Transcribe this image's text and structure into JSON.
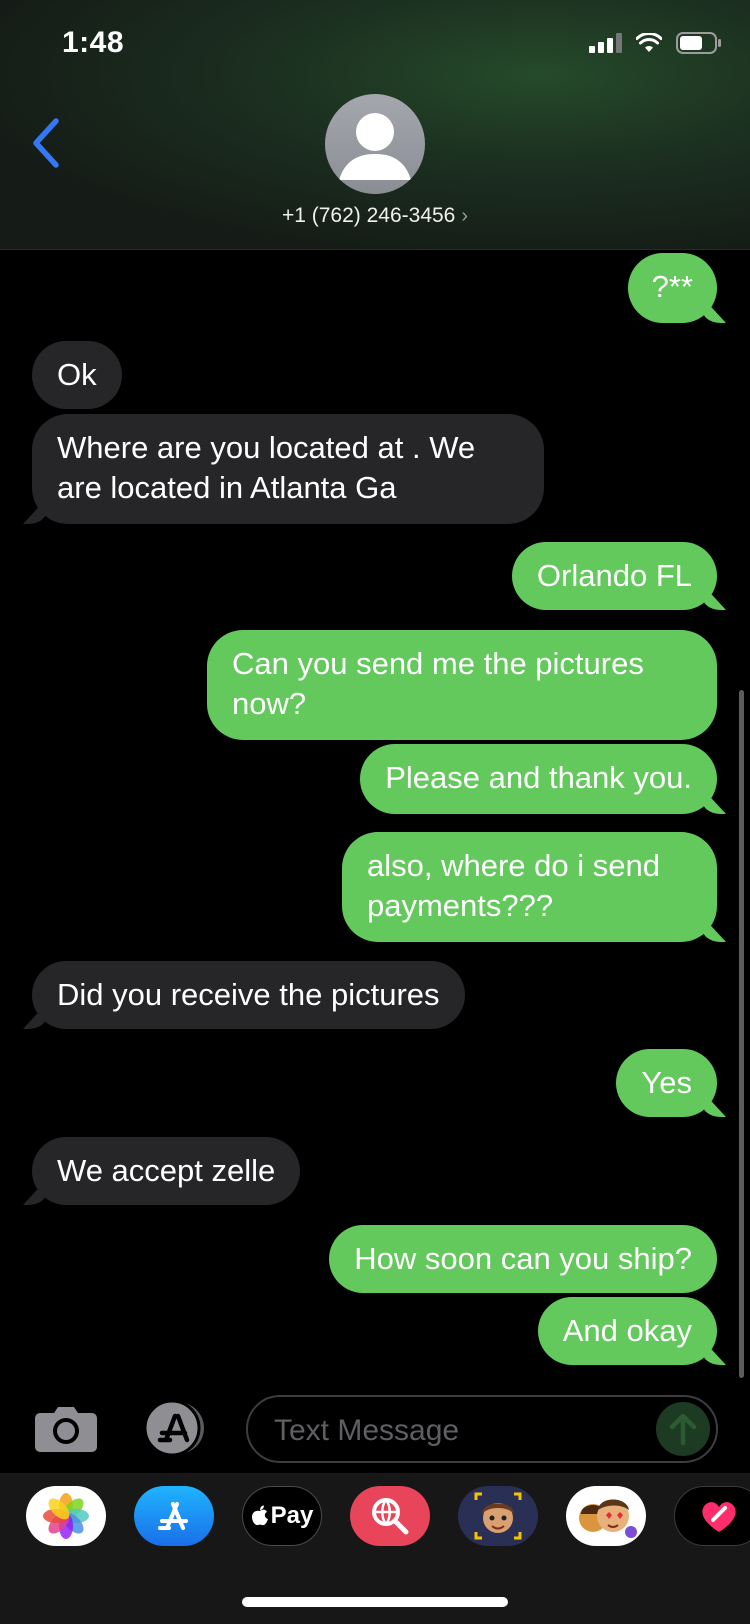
{
  "status_bar": {
    "time": "1:48"
  },
  "header": {
    "contact": "+1 (762) 246-3456",
    "chevron": "›"
  },
  "messages": [
    {
      "from": "me",
      "text": "?**"
    },
    {
      "from": "them",
      "text": "Ok"
    },
    {
      "from": "them",
      "text": "Where are you located at . We\nare located in Atlanta Ga"
    },
    {
      "from": "me",
      "text": "Orlando FL"
    },
    {
      "from": "me",
      "text": "Can you send me the pictures\nnow?"
    },
    {
      "from": "me",
      "text": "Please and thank you."
    },
    {
      "from": "me",
      "text": "also, where do i send\npayments???"
    },
    {
      "from": "them",
      "text": "Did you receive the pictures"
    },
    {
      "from": "me",
      "text": "Yes"
    },
    {
      "from": "them",
      "text": "We accept zelle"
    },
    {
      "from": "me",
      "text": "How soon can you ship?"
    },
    {
      "from": "me",
      "text": "And okay"
    }
  ],
  "composer": {
    "placeholder": "Text Message"
  },
  "app_drawer": {
    "apps": [
      {
        "icon": "photos-icon"
      },
      {
        "icon": "app-store-icon"
      },
      {
        "icon": "apple-pay-icon",
        "label": "Pay"
      },
      {
        "icon": "web-search-icon"
      },
      {
        "icon": "memoji-icon"
      },
      {
        "icon": "animoji-stickers-icon"
      },
      {
        "icon": "digital-touch-icon"
      }
    ]
  },
  "colors": {
    "sent_bubble": "#63c95c",
    "received_bubble": "#262628",
    "accent": "#3478f6"
  }
}
